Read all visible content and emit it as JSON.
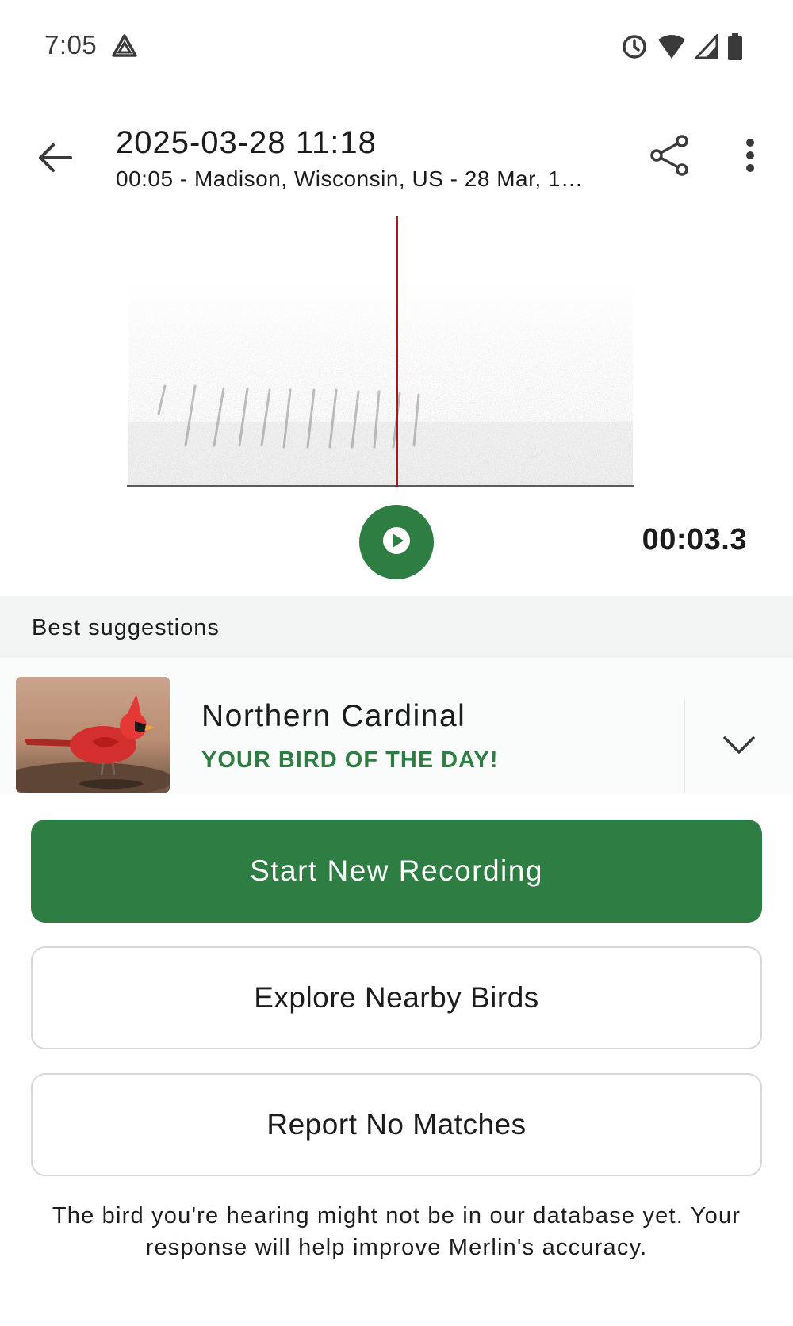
{
  "status_bar": {
    "time": "7:05",
    "icons": [
      "alert-triangle-icon",
      "alarm-icon",
      "wifi-icon",
      "cell-signal-icon",
      "battery-icon"
    ]
  },
  "header": {
    "title": "2025-03-28 11:18",
    "subtitle": "00:05 - Madison, Wisconsin, US - 28 Mar, 1…",
    "icons": [
      "back-arrow-icon",
      "share-icon",
      "more-vert-icon"
    ]
  },
  "player": {
    "time": "00:03.3",
    "play_icon": "play-icon",
    "playhead_color": "#a11d1d"
  },
  "suggestions": {
    "section_label": "Best suggestions",
    "items": [
      {
        "name": "Northern Cardinal",
        "badge": "YOUR BIRD OF THE DAY!",
        "image": "northern-cardinal-photo"
      }
    ]
  },
  "actions": {
    "start_recording": "Start New Recording",
    "explore": "Explore Nearby Birds",
    "report": "Report No Matches"
  },
  "footer": {
    "note": "The bird you're hearing might not be in our database yet. Your response will help improve Merlin's accuracy."
  },
  "colors": {
    "accent": "#2e7d43",
    "text": "#1c1c1c",
    "section_bg": "#f3f5f4"
  }
}
